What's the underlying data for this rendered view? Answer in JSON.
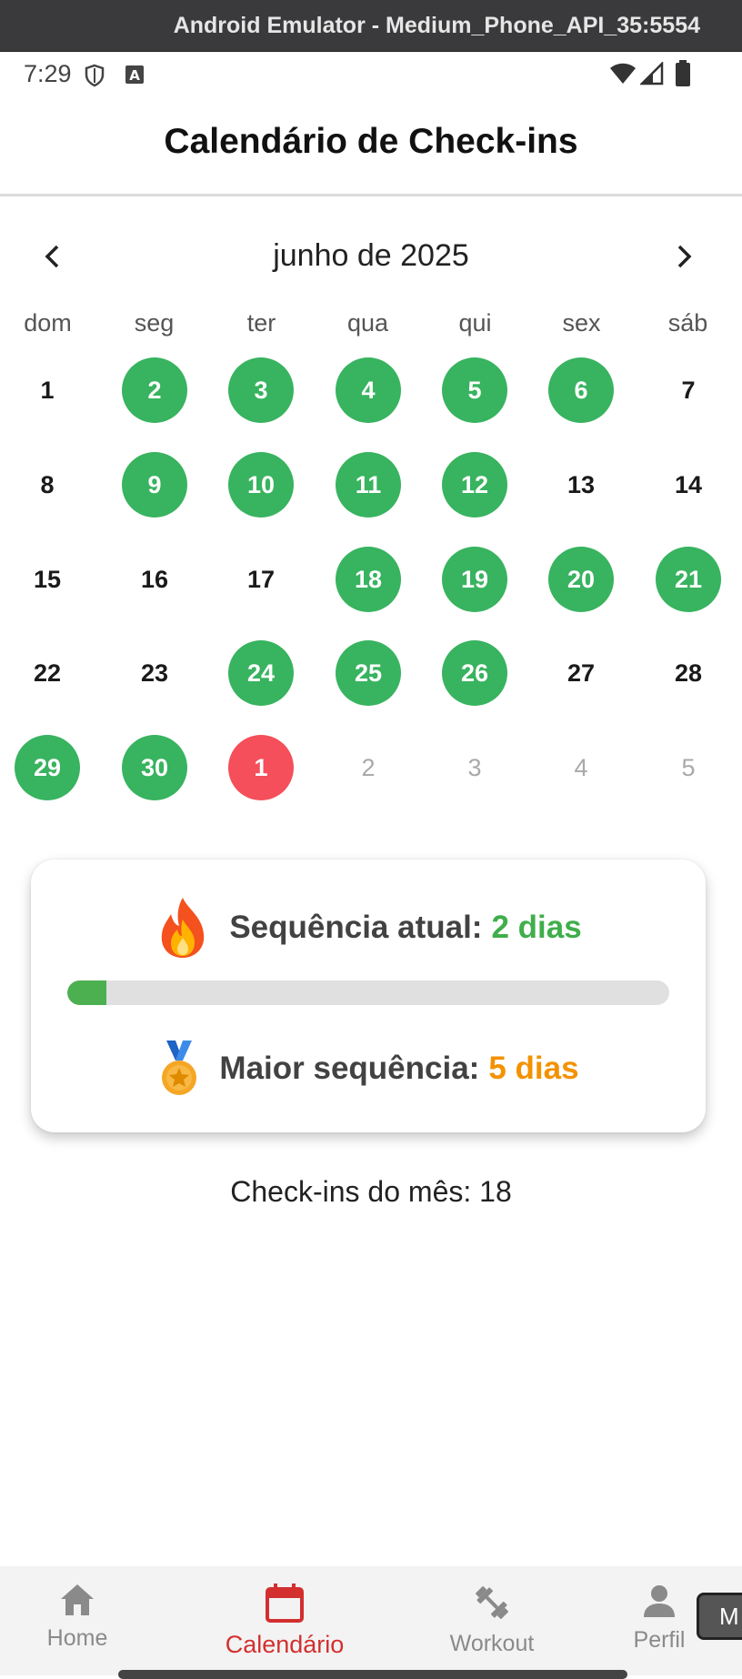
{
  "emulator": {
    "title": "Android Emulator - Medium_Phone_API_35:5554"
  },
  "status_bar": {
    "time": "7:29",
    "icons": [
      "shield-icon",
      "keyboard-a-icon",
      "wifi-icon",
      "signal-icon",
      "battery-icon"
    ]
  },
  "app_bar": {
    "title": "Calendário de Check-ins"
  },
  "calendar": {
    "month_label": "junho de 2025",
    "prev_icon": "chevron-left-icon",
    "next_icon": "chevron-right-icon",
    "weekdays": [
      "dom",
      "seg",
      "ter",
      "qua",
      "qui",
      "sex",
      "sáb"
    ],
    "weeks": [
      [
        {
          "d": "1",
          "s": "none"
        },
        {
          "d": "2",
          "s": "checked"
        },
        {
          "d": "3",
          "s": "checked"
        },
        {
          "d": "4",
          "s": "checked"
        },
        {
          "d": "5",
          "s": "checked"
        },
        {
          "d": "6",
          "s": "checked"
        },
        {
          "d": "7",
          "s": "none"
        }
      ],
      [
        {
          "d": "8",
          "s": "none"
        },
        {
          "d": "9",
          "s": "checked"
        },
        {
          "d": "10",
          "s": "checked"
        },
        {
          "d": "11",
          "s": "checked"
        },
        {
          "d": "12",
          "s": "checked"
        },
        {
          "d": "13",
          "s": "none"
        },
        {
          "d": "14",
          "s": "none"
        }
      ],
      [
        {
          "d": "15",
          "s": "none"
        },
        {
          "d": "16",
          "s": "none"
        },
        {
          "d": "17",
          "s": "none"
        },
        {
          "d": "18",
          "s": "checked"
        },
        {
          "d": "19",
          "s": "checked"
        },
        {
          "d": "20",
          "s": "checked"
        },
        {
          "d": "21",
          "s": "checked"
        }
      ],
      [
        {
          "d": "22",
          "s": "none"
        },
        {
          "d": "23",
          "s": "none"
        },
        {
          "d": "24",
          "s": "checked"
        },
        {
          "d": "25",
          "s": "checked"
        },
        {
          "d": "26",
          "s": "checked"
        },
        {
          "d": "27",
          "s": "none"
        },
        {
          "d": "28",
          "s": "none"
        }
      ],
      [
        {
          "d": "29",
          "s": "checked"
        },
        {
          "d": "30",
          "s": "checked"
        },
        {
          "d": "1",
          "s": "missed"
        },
        {
          "d": "2",
          "s": "outside"
        },
        {
          "d": "3",
          "s": "outside"
        },
        {
          "d": "4",
          "s": "outside"
        },
        {
          "d": "5",
          "s": "outside"
        }
      ]
    ],
    "colors": {
      "checked": "#38b35f",
      "missed": "#f44f5a",
      "outside_text": "#a9a9a9"
    }
  },
  "streak_card": {
    "current_label": "Sequência atual:",
    "current_value": "2 dias",
    "current_icon": "fire-icon",
    "progress_fraction": 0.065,
    "best_label": "Maior sequência:",
    "best_value": "5 dias",
    "best_icon": "medal-icon"
  },
  "month_summary": "Check-ins do mês: 18",
  "bottom_nav": {
    "items": [
      {
        "label": "Home",
        "icon": "home-icon",
        "active": false
      },
      {
        "label": "Calendário",
        "icon": "calendar-icon",
        "active": true
      },
      {
        "label": "Workout",
        "icon": "dumbbell-icon",
        "active": false
      },
      {
        "label": "Perfil",
        "icon": "person-icon",
        "active": false
      }
    ],
    "active_color": "#d32f2f"
  },
  "side_tab_label": "M"
}
